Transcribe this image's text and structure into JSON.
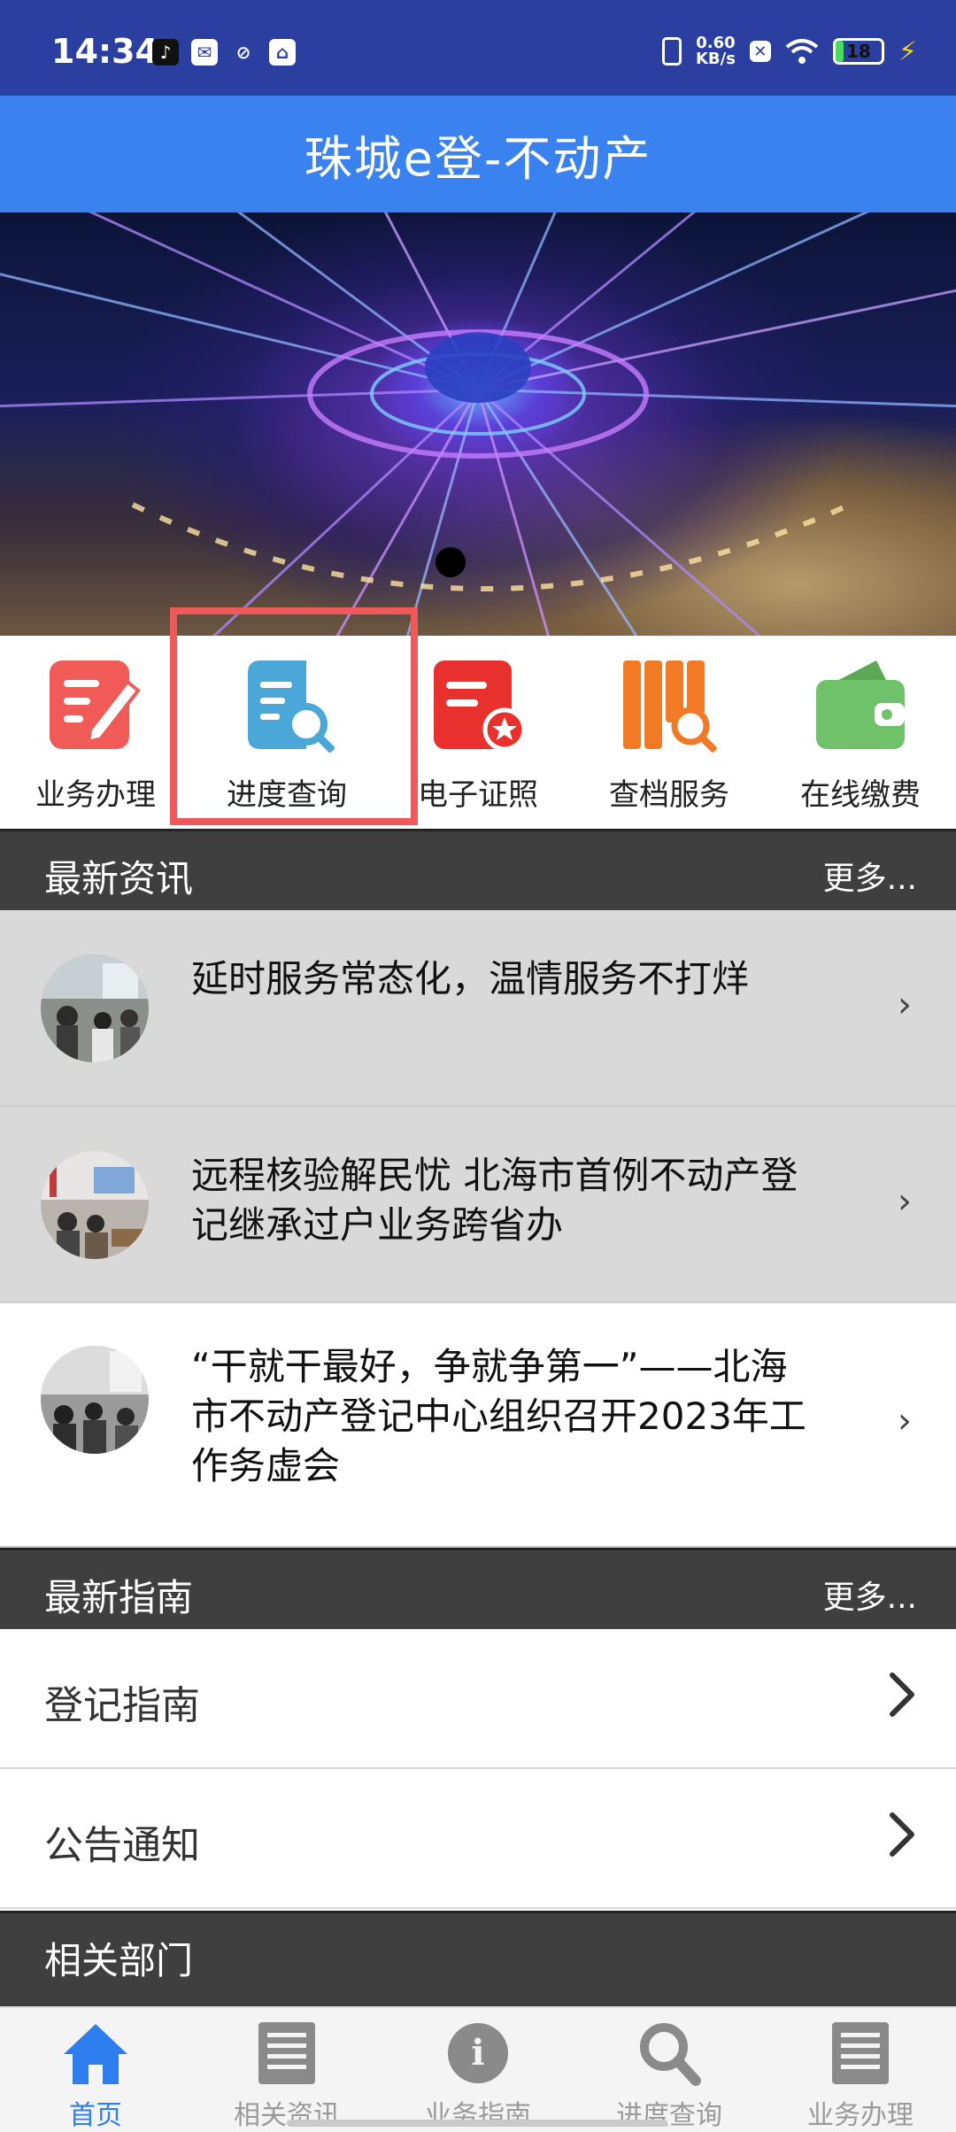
{
  "status_bar": {
    "time": "14:34",
    "net_speed_value": "0.60",
    "net_speed_unit": "KB/s",
    "battery_level": "18",
    "icons": [
      "tiktok-icon",
      "mail-icon",
      "link-icon",
      "app-icon",
      "vibrate-icon",
      "x-icon",
      "wifi-icon",
      "battery-icon",
      "charging-icon"
    ]
  },
  "header": {
    "title": "珠城e登-不动产"
  },
  "banner": {
    "indicator_count": 1,
    "active_index": 0
  },
  "quick_menu": {
    "items": [
      {
        "label": "业务办理",
        "icon": "edit-doc-icon",
        "color": "#f05a57"
      },
      {
        "label": "进度查询",
        "icon": "doc-search-icon",
        "color": "#4aa7d8"
      },
      {
        "label": "电子证照",
        "icon": "certificate-icon",
        "color": "#e8312d"
      },
      {
        "label": "查档服务",
        "icon": "archive-search-icon",
        "color": "#f37a24"
      },
      {
        "label": "在线缴费",
        "icon": "wallet-icon",
        "color": "#6fc16a"
      }
    ]
  },
  "news_section": {
    "title": "最新资讯",
    "more": "更多...",
    "items": [
      {
        "text": "延时服务常态化，温情服务不打烊"
      },
      {
        "text": "远程核验解民忧 北海市首例不动产登记继承过户业务跨省办"
      },
      {
        "text": "“干就干最好，争就争第一”——北海市不动产登记中心组织召开2023年工作务虚会"
      }
    ]
  },
  "guide_section": {
    "title": "最新指南",
    "more": "更多...",
    "items": [
      {
        "label": "登记指南"
      },
      {
        "label": "公告通知"
      }
    ]
  },
  "departments_section": {
    "title": "相关部门"
  },
  "bottom_nav": {
    "active_color": "#2f7ef0",
    "items": [
      {
        "label": "首页",
        "icon": "home-icon"
      },
      {
        "label": "相关资讯",
        "icon": "news-icon"
      },
      {
        "label": "业务指南",
        "icon": "info-icon"
      },
      {
        "label": "进度查询",
        "icon": "search-icon"
      },
      {
        "label": "业务办理",
        "icon": "document-icon"
      }
    ]
  }
}
